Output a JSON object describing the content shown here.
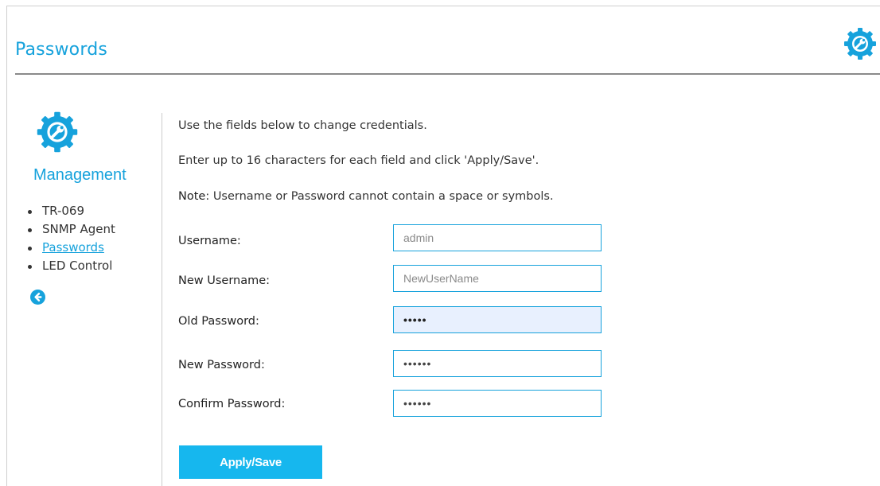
{
  "header": {
    "title": "Passwords",
    "icon": "settings-wrench-icon",
    "accent_color": "#16a2dc"
  },
  "sidebar": {
    "icon": "settings-wrench-icon",
    "title": "Management",
    "items": [
      {
        "label": "TR-069",
        "active": false
      },
      {
        "label": "SNMP Agent",
        "active": false
      },
      {
        "label": "Passwords",
        "active": true
      },
      {
        "label": "LED Control",
        "active": false
      }
    ],
    "back_icon": "back-arrow-icon"
  },
  "main": {
    "intro": "Use the fields below to change credentials.",
    "instructions": "Enter up to 16 characters for each field and click 'Apply/Save'.",
    "note_label": "Note",
    "note_text": ": Username or Password cannot contain a space or symbols.",
    "fields": {
      "username": {
        "label": "Username:",
        "value": "",
        "placeholder": "admin"
      },
      "new_username": {
        "label": "New Username:",
        "value": "",
        "placeholder": "NewUserName"
      },
      "old_password": {
        "label": "Old Password:",
        "value": "•••••",
        "placeholder": ""
      },
      "new_password": {
        "label": "New Password:",
        "value": "••••••",
        "placeholder": ""
      },
      "confirm_password": {
        "label": "Confirm Password:",
        "value": "••••••",
        "placeholder": ""
      }
    },
    "apply_label": "Apply/Save",
    "button_color": "#16b7ee"
  }
}
